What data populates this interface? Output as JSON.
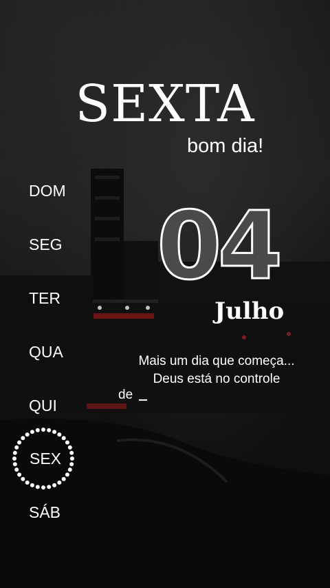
{
  "header": {
    "weekday_title": "SEXTA",
    "greeting": "bom dia!"
  },
  "week": {
    "days": [
      "DOM",
      "SEG",
      "TER",
      "QUA",
      "QUI",
      "SEX",
      "SÁB"
    ],
    "selected": "SEX"
  },
  "date": {
    "day_number": "04",
    "month": "Julho"
  },
  "message": {
    "line1": "Mais um dia que começa...",
    "line2": "Deus está no controle",
    "line3": "de"
  },
  "colors": {
    "background": "#131313",
    "text": "#ffffff",
    "number_fill": "#4a4a4a",
    "ring": "#ffffff"
  }
}
